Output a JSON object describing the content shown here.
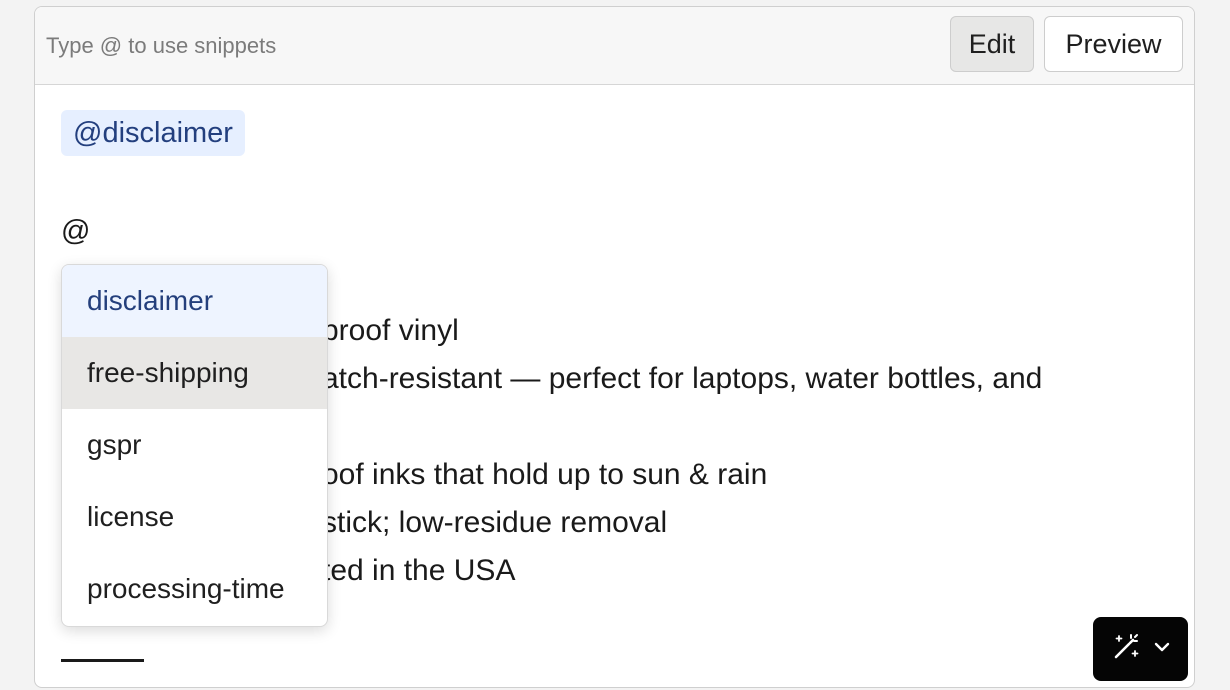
{
  "toolbar": {
    "hint": "Type @ to use snippets",
    "edit_label": "Edit",
    "preview_label": "Preview"
  },
  "editor": {
    "snippet_chip": "@disclaimer",
    "at_trigger": "@",
    "lines": [
      "proof vinyl",
      "atch-resistant — perfect for laptops, water bottles, and",
      "oof inks that hold up to sun & rain",
      "stick; low-residue removal",
      "ted in the USA"
    ]
  },
  "dropdown": {
    "items": [
      {
        "label": "disclaimer",
        "state": "selected"
      },
      {
        "label": "free-shipping",
        "state": "hover"
      },
      {
        "label": "gspr",
        "state": ""
      },
      {
        "label": "license",
        "state": ""
      },
      {
        "label": "processing-time",
        "state": ""
      }
    ]
  },
  "ai_button": {
    "icons": [
      "magic-wand-icon",
      "chevron-down-icon"
    ]
  },
  "colors": {
    "chip_bg": "#e6efff",
    "chip_text": "#233f7e",
    "selected_bg": "#eef4ff",
    "hover_bg": "#e8e7e5",
    "ai_button_bg": "#050505"
  }
}
